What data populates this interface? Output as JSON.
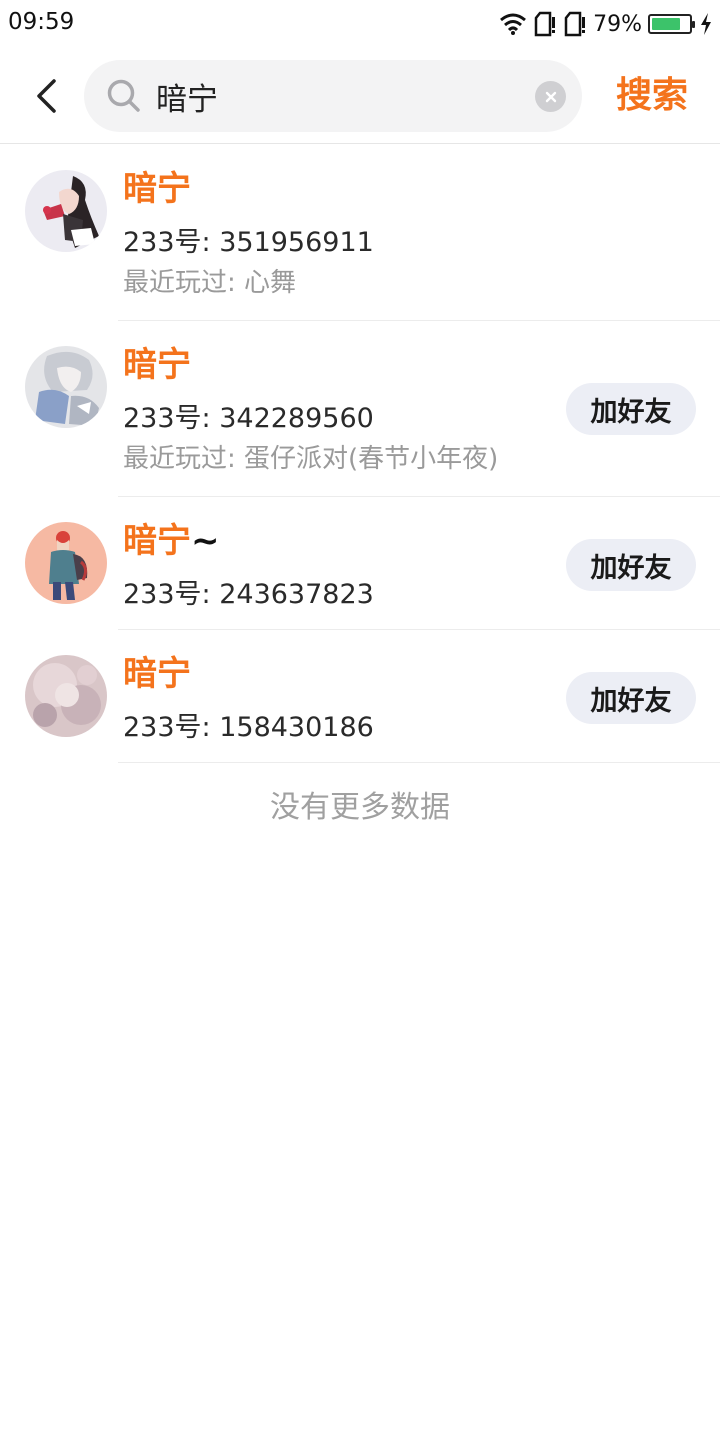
{
  "status_bar": {
    "time": "09:59",
    "battery_percent": "79%",
    "battery_level": 0.79,
    "icons": [
      "wifi-icon",
      "sim1-no-signal-icon",
      "sim2-no-signal-icon",
      "battery-icon",
      "charging-icon"
    ]
  },
  "search": {
    "query": "暗宁",
    "submit_label": "搜索",
    "accent_color": "#f4731c"
  },
  "results": [
    {
      "name": "暗宁",
      "name_suffix": "",
      "uid": "233号: 351956911",
      "recent": "最近玩过: 心舞",
      "show_add": false,
      "add_label": "加好友"
    },
    {
      "name": "暗宁",
      "name_suffix": "",
      "uid": "233号: 342289560",
      "recent": "最近玩过: 蛋仔派对(春节小年夜)",
      "show_add": true,
      "add_label": "加好友"
    },
    {
      "name": "暗宁",
      "name_suffix": "~",
      "uid": "233号: 243637823",
      "recent": "",
      "show_add": true,
      "add_label": "加好友"
    },
    {
      "name": "暗宁",
      "name_suffix": "",
      "uid": "233号: 158430186",
      "recent": "",
      "show_add": true,
      "add_label": "加好友"
    }
  ],
  "footer": {
    "no_more_text": "没有更多数据"
  }
}
